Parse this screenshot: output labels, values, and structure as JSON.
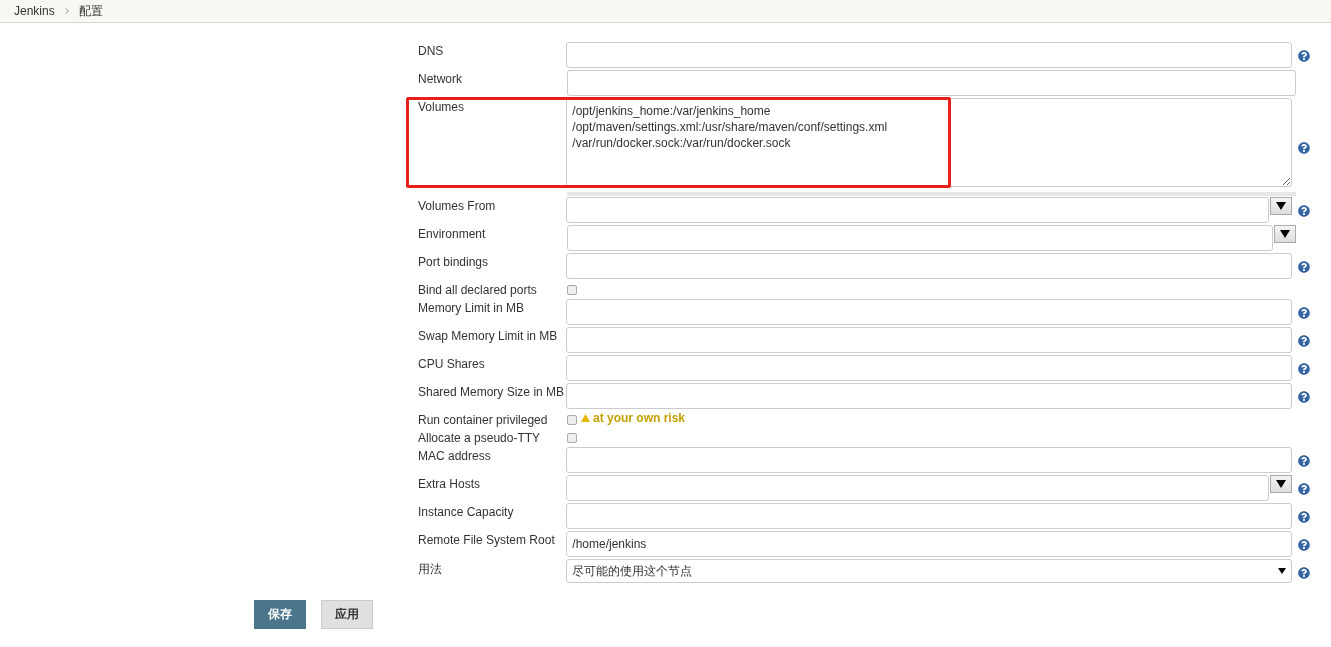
{
  "breadcrumbs": [
    {
      "label": "Jenkins"
    },
    {
      "label": "配置"
    }
  ],
  "fields": [
    {
      "label": "DNS",
      "kind": "text",
      "help": true
    },
    {
      "label": "Network",
      "kind": "text",
      "help": false
    },
    {
      "label": "Volumes",
      "kind": "textarea",
      "help": true,
      "highlighted": true,
      "value": "/opt/jenkins_home:/var/jenkins_home\n/opt/maven/settings.xml:/usr/share/maven/conf/settings.xml\n/var/run/docker.sock:/var/run/docker.sock"
    },
    {
      "label": "Volumes From",
      "kind": "combo",
      "help": true
    },
    {
      "label": "Environment",
      "kind": "combo",
      "help": false
    },
    {
      "label": "Port bindings",
      "kind": "text",
      "help": true
    },
    {
      "label": "Bind all declared ports",
      "kind": "checkbox",
      "checked": false
    },
    {
      "label": "Memory Limit in MB",
      "kind": "text",
      "help": true
    },
    {
      "label": "Swap Memory Limit in MB",
      "kind": "text",
      "help": true
    },
    {
      "label": "CPU Shares",
      "kind": "text",
      "help": true
    },
    {
      "label": "Shared Memory Size in MB",
      "kind": "text",
      "help": true
    },
    {
      "label": "Run container privileged",
      "kind": "checkbox",
      "checked": false,
      "warning": "at your own risk"
    },
    {
      "label": "Allocate a pseudo-TTY",
      "kind": "checkbox",
      "checked": false
    },
    {
      "label": "MAC address",
      "kind": "text",
      "help": true
    },
    {
      "label": "Extra Hosts",
      "kind": "combo",
      "help": true
    },
    {
      "label": "Instance Capacity",
      "kind": "text",
      "help": true
    },
    {
      "label": "Remote File System Root",
      "kind": "text",
      "help": true,
      "value": "/home/jenkins"
    },
    {
      "label": "用法",
      "kind": "select",
      "help": true,
      "value": "尽可能的使用这个节点"
    }
  ],
  "buttons": [
    {
      "label": "保存",
      "kind": "primary"
    },
    {
      "label": "应用",
      "kind": "secondary"
    }
  ]
}
